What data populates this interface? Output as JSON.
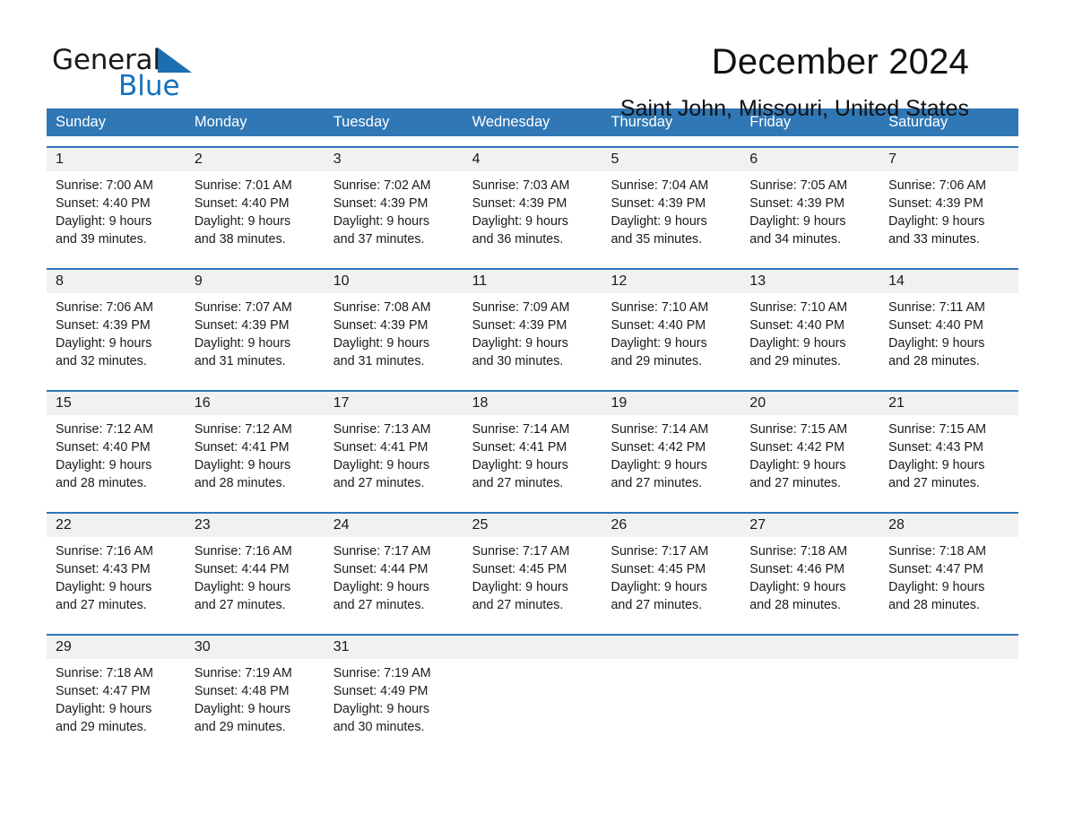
{
  "brand": {
    "name_part1": "General",
    "name_part2": "Blue",
    "triangle_color": "#1b6fb0",
    "blue_color": "#1572c0"
  },
  "header": {
    "month_title": "December 2024",
    "location": "Saint John, Missouri, United States"
  },
  "theme": {
    "header_blue": "#2f77b5",
    "daynum_band": "#f1f1f1",
    "text": "#1a1a1a"
  },
  "weekdays": [
    "Sunday",
    "Monday",
    "Tuesday",
    "Wednesday",
    "Thursday",
    "Friday",
    "Saturday"
  ],
  "weeks": [
    [
      {
        "day": "1",
        "sunrise": "Sunrise: 7:00 AM",
        "sunset": "Sunset: 4:40 PM",
        "daylight_line1": "Daylight: 9 hours",
        "daylight_line2": "and 39 minutes."
      },
      {
        "day": "2",
        "sunrise": "Sunrise: 7:01 AM",
        "sunset": "Sunset: 4:40 PM",
        "daylight_line1": "Daylight: 9 hours",
        "daylight_line2": "and 38 minutes."
      },
      {
        "day": "3",
        "sunrise": "Sunrise: 7:02 AM",
        "sunset": "Sunset: 4:39 PM",
        "daylight_line1": "Daylight: 9 hours",
        "daylight_line2": "and 37 minutes."
      },
      {
        "day": "4",
        "sunrise": "Sunrise: 7:03 AM",
        "sunset": "Sunset: 4:39 PM",
        "daylight_line1": "Daylight: 9 hours",
        "daylight_line2": "and 36 minutes."
      },
      {
        "day": "5",
        "sunrise": "Sunrise: 7:04 AM",
        "sunset": "Sunset: 4:39 PM",
        "daylight_line1": "Daylight: 9 hours",
        "daylight_line2": "and 35 minutes."
      },
      {
        "day": "6",
        "sunrise": "Sunrise: 7:05 AM",
        "sunset": "Sunset: 4:39 PM",
        "daylight_line1": "Daylight: 9 hours",
        "daylight_line2": "and 34 minutes."
      },
      {
        "day": "7",
        "sunrise": "Sunrise: 7:06 AM",
        "sunset": "Sunset: 4:39 PM",
        "daylight_line1": "Daylight: 9 hours",
        "daylight_line2": "and 33 minutes."
      }
    ],
    [
      {
        "day": "8",
        "sunrise": "Sunrise: 7:06 AM",
        "sunset": "Sunset: 4:39 PM",
        "daylight_line1": "Daylight: 9 hours",
        "daylight_line2": "and 32 minutes."
      },
      {
        "day": "9",
        "sunrise": "Sunrise: 7:07 AM",
        "sunset": "Sunset: 4:39 PM",
        "daylight_line1": "Daylight: 9 hours",
        "daylight_line2": "and 31 minutes."
      },
      {
        "day": "10",
        "sunrise": "Sunrise: 7:08 AM",
        "sunset": "Sunset: 4:39 PM",
        "daylight_line1": "Daylight: 9 hours",
        "daylight_line2": "and 31 minutes."
      },
      {
        "day": "11",
        "sunrise": "Sunrise: 7:09 AM",
        "sunset": "Sunset: 4:39 PM",
        "daylight_line1": "Daylight: 9 hours",
        "daylight_line2": "and 30 minutes."
      },
      {
        "day": "12",
        "sunrise": "Sunrise: 7:10 AM",
        "sunset": "Sunset: 4:40 PM",
        "daylight_line1": "Daylight: 9 hours",
        "daylight_line2": "and 29 minutes."
      },
      {
        "day": "13",
        "sunrise": "Sunrise: 7:10 AM",
        "sunset": "Sunset: 4:40 PM",
        "daylight_line1": "Daylight: 9 hours",
        "daylight_line2": "and 29 minutes."
      },
      {
        "day": "14",
        "sunrise": "Sunrise: 7:11 AM",
        "sunset": "Sunset: 4:40 PM",
        "daylight_line1": "Daylight: 9 hours",
        "daylight_line2": "and 28 minutes."
      }
    ],
    [
      {
        "day": "15",
        "sunrise": "Sunrise: 7:12 AM",
        "sunset": "Sunset: 4:40 PM",
        "daylight_line1": "Daylight: 9 hours",
        "daylight_line2": "and 28 minutes."
      },
      {
        "day": "16",
        "sunrise": "Sunrise: 7:12 AM",
        "sunset": "Sunset: 4:41 PM",
        "daylight_line1": "Daylight: 9 hours",
        "daylight_line2": "and 28 minutes."
      },
      {
        "day": "17",
        "sunrise": "Sunrise: 7:13 AM",
        "sunset": "Sunset: 4:41 PM",
        "daylight_line1": "Daylight: 9 hours",
        "daylight_line2": "and 27 minutes."
      },
      {
        "day": "18",
        "sunrise": "Sunrise: 7:14 AM",
        "sunset": "Sunset: 4:41 PM",
        "daylight_line1": "Daylight: 9 hours",
        "daylight_line2": "and 27 minutes."
      },
      {
        "day": "19",
        "sunrise": "Sunrise: 7:14 AM",
        "sunset": "Sunset: 4:42 PM",
        "daylight_line1": "Daylight: 9 hours",
        "daylight_line2": "and 27 minutes."
      },
      {
        "day": "20",
        "sunrise": "Sunrise: 7:15 AM",
        "sunset": "Sunset: 4:42 PM",
        "daylight_line1": "Daylight: 9 hours",
        "daylight_line2": "and 27 minutes."
      },
      {
        "day": "21",
        "sunrise": "Sunrise: 7:15 AM",
        "sunset": "Sunset: 4:43 PM",
        "daylight_line1": "Daylight: 9 hours",
        "daylight_line2": "and 27 minutes."
      }
    ],
    [
      {
        "day": "22",
        "sunrise": "Sunrise: 7:16 AM",
        "sunset": "Sunset: 4:43 PM",
        "daylight_line1": "Daylight: 9 hours",
        "daylight_line2": "and 27 minutes."
      },
      {
        "day": "23",
        "sunrise": "Sunrise: 7:16 AM",
        "sunset": "Sunset: 4:44 PM",
        "daylight_line1": "Daylight: 9 hours",
        "daylight_line2": "and 27 minutes."
      },
      {
        "day": "24",
        "sunrise": "Sunrise: 7:17 AM",
        "sunset": "Sunset: 4:44 PM",
        "daylight_line1": "Daylight: 9 hours",
        "daylight_line2": "and 27 minutes."
      },
      {
        "day": "25",
        "sunrise": "Sunrise: 7:17 AM",
        "sunset": "Sunset: 4:45 PM",
        "daylight_line1": "Daylight: 9 hours",
        "daylight_line2": "and 27 minutes."
      },
      {
        "day": "26",
        "sunrise": "Sunrise: 7:17 AM",
        "sunset": "Sunset: 4:45 PM",
        "daylight_line1": "Daylight: 9 hours",
        "daylight_line2": "and 27 minutes."
      },
      {
        "day": "27",
        "sunrise": "Sunrise: 7:18 AM",
        "sunset": "Sunset: 4:46 PM",
        "daylight_line1": "Daylight: 9 hours",
        "daylight_line2": "and 28 minutes."
      },
      {
        "day": "28",
        "sunrise": "Sunrise: 7:18 AM",
        "sunset": "Sunset: 4:47 PM",
        "daylight_line1": "Daylight: 9 hours",
        "daylight_line2": "and 28 minutes."
      }
    ],
    [
      {
        "day": "29",
        "sunrise": "Sunrise: 7:18 AM",
        "sunset": "Sunset: 4:47 PM",
        "daylight_line1": "Daylight: 9 hours",
        "daylight_line2": "and 29 minutes."
      },
      {
        "day": "30",
        "sunrise": "Sunrise: 7:19 AM",
        "sunset": "Sunset: 4:48 PM",
        "daylight_line1": "Daylight: 9 hours",
        "daylight_line2": "and 29 minutes."
      },
      {
        "day": "31",
        "sunrise": "Sunrise: 7:19 AM",
        "sunset": "Sunset: 4:49 PM",
        "daylight_line1": "Daylight: 9 hours",
        "daylight_line2": "and 30 minutes."
      },
      {
        "day": "",
        "sunrise": "",
        "sunset": "",
        "daylight_line1": "",
        "daylight_line2": ""
      },
      {
        "day": "",
        "sunrise": "",
        "sunset": "",
        "daylight_line1": "",
        "daylight_line2": ""
      },
      {
        "day": "",
        "sunrise": "",
        "sunset": "",
        "daylight_line1": "",
        "daylight_line2": ""
      },
      {
        "day": "",
        "sunrise": "",
        "sunset": "",
        "daylight_line1": "",
        "daylight_line2": ""
      }
    ]
  ]
}
